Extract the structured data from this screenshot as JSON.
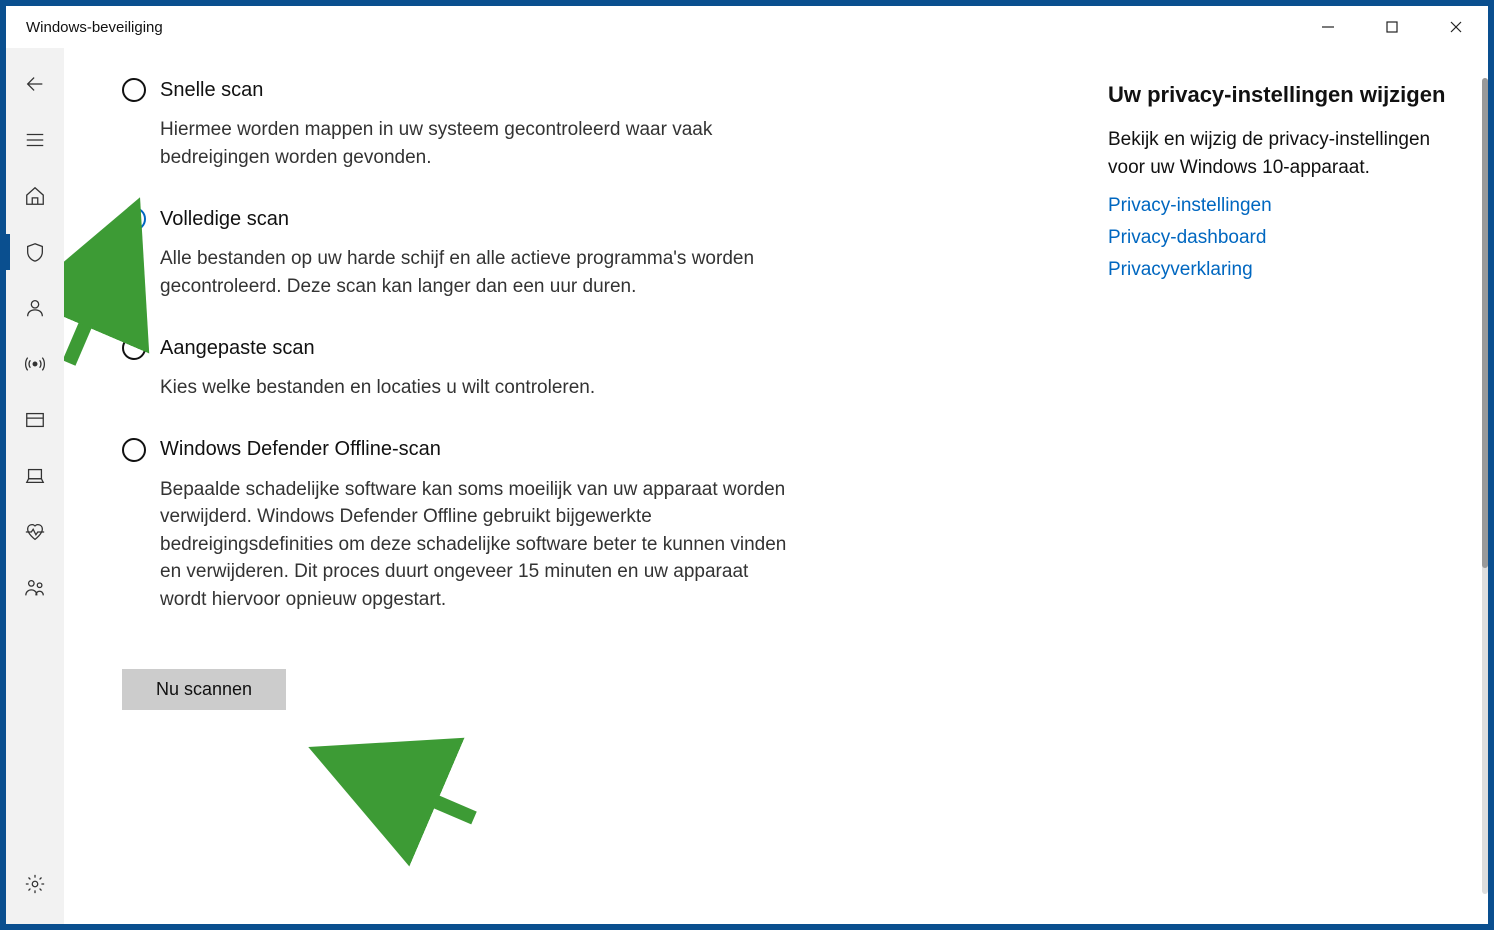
{
  "window": {
    "title": "Windows-beveiliging"
  },
  "scan_options": [
    {
      "label": "Snelle scan",
      "desc": "Hiermee worden mappen in uw systeem gecontroleerd waar vaak bedreigingen worden gevonden.",
      "selected": false
    },
    {
      "label": "Volledige scan",
      "desc": "Alle bestanden op uw harde schijf en alle actieve programma's worden gecontroleerd. Deze scan kan langer dan een uur duren.",
      "selected": true
    },
    {
      "label": "Aangepaste scan",
      "desc": "Kies welke bestanden en locaties u wilt controleren.",
      "selected": false
    },
    {
      "label": "Windows Defender Offline-scan",
      "desc": "Bepaalde schadelijke software kan soms moeilijk van uw apparaat worden verwijderd. Windows Defender Offline gebruikt bijgewerkte bedreigingsdefinities om deze schadelijke software beter te kunnen vinden en verwijderen. Dit proces duurt ongeveer 15 minuten en uw apparaat wordt hiervoor opnieuw opgestart.",
      "selected": false
    }
  ],
  "scan_button": "Nu scannen",
  "right": {
    "heading": "Uw privacy-instellingen wijzigen",
    "text": "Bekijk en wijzig de privacy-instellingen voor uw Windows 10-apparaat.",
    "links": [
      "Privacy-instellingen",
      "Privacy-dashboard",
      "Privacyverklaring"
    ]
  }
}
